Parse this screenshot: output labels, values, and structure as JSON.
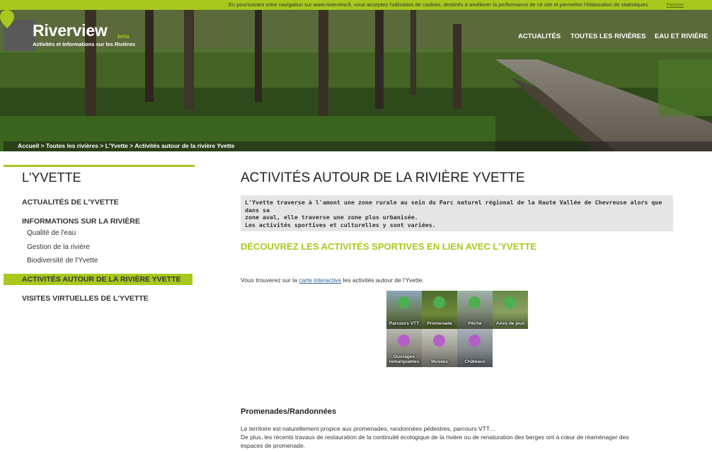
{
  "cookie": {
    "text": "En poursuivant votre navigation sur www.riverview.fr, vous acceptez l'utilisation de cookies, destinés à améliorer la performance de ce site et permettre l'élaboration de statistiques",
    "close_label": "Fermer"
  },
  "header": {
    "brand": "Riverview",
    "beta": "beta",
    "tagline": "Activités et Informations sur les Rivières",
    "nav": [
      "ACTUALITÉS",
      "TOUTES LES RIVIÈRES",
      "EAU ET RIVIÈRE"
    ]
  },
  "breadcrumb": "Accueil > Toutes les rivières > L'Yvette > Activités autour de la rivière Yvette",
  "sidebar": {
    "title": "L'YVETTE",
    "items": [
      {
        "label": "ACTUALITÉS DE L'YVETTE"
      },
      {
        "label": "INFORMATIONS SUR LA RIVIÈRE"
      },
      {
        "label": "Qualité de l'eau"
      },
      {
        "label": "Gestion de la rivière"
      },
      {
        "label": "Biodiversité de l'Yvette"
      },
      {
        "label": "ACTIVITÉS AUTOUR DE LA RIVIÈRE YVETTE"
      },
      {
        "label": "VISITES VIRTUELLES DE L'YVETTE"
      }
    ]
  },
  "main": {
    "title": "ACTIVITÉS AUTOUR DE LA RIVIÈRE YVETTE",
    "intro_line1": "L'Yvette traverse à l'amont une zone rurale au sein du Parc naturel régional de la Haute Vallée de Chevreuse alors que dans sa",
    "intro_line2": "zone aval, elle traverse une zone plus urbanisée.",
    "intro_line3": "Les activités sportives et culturelles y sont variées.",
    "section_title": "DÉCOUVREZ LES ACTIVITÉS SPORTIVES EN LIEN AVEC L'YVETTE",
    "map_text_before": "Vous trouverez sur la",
    "map_link": "carte interactive",
    "map_text_after": "les activités autour de l'Yvette.",
    "tiles": [
      {
        "label": "Parcours VTT",
        "color": "#4caf50",
        "icon": "bicycle-icon"
      },
      {
        "label": "Promenade",
        "color": "#4caf50",
        "icon": "basket-icon"
      },
      {
        "label": "Pêche",
        "color": "#4caf50",
        "icon": "fishing-hook-icon"
      },
      {
        "label": "Aires de jeux",
        "color": "#4caf50",
        "icon": "playground-icon"
      },
      {
        "label": "Ouvrages remarquables",
        "color": "#b55ec8",
        "icon": "bridge-icon"
      },
      {
        "label": "Musées",
        "color": "#b55ec8",
        "icon": "museum-icon"
      },
      {
        "label": "Châteaux",
        "color": "#b55ec8",
        "icon": "castle-icon"
      }
    ],
    "subheading": "Promenades/Randonnées",
    "para_line1": "Le territoire est naturellement propice aux promenades, randonnées pédestres, parcours VTT…",
    "para_line2": "De plus, les récents travaux de restauration de la continuité écologique de la rivière ou de renaturation des berges ont à cœur de réaménager des",
    "para_line3": "espaces de promenade."
  }
}
